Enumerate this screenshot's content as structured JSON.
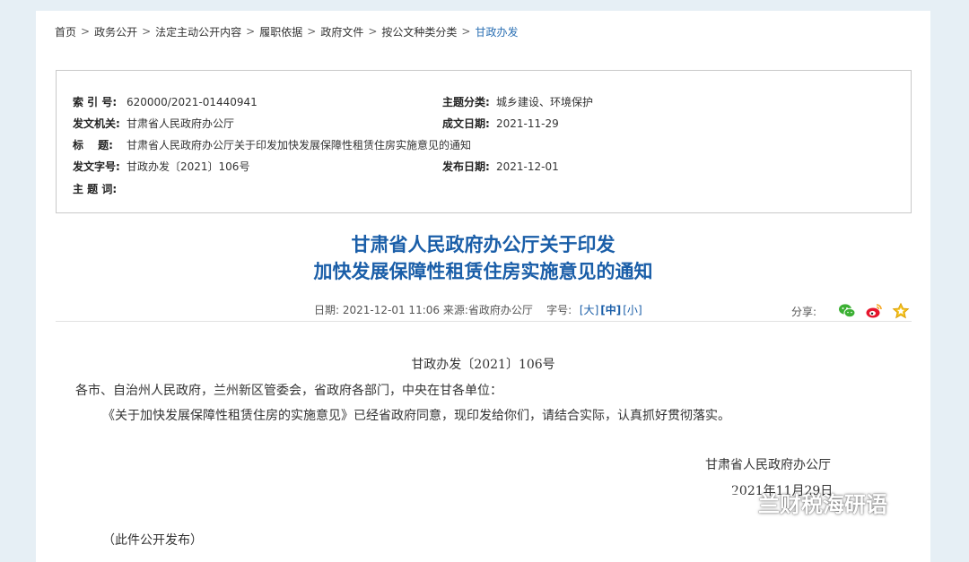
{
  "breadcrumb": {
    "items": [
      "首页",
      "政务公开",
      "法定主动公开内容",
      "履职依据",
      "政府文件",
      "按公文种类分类"
    ],
    "current": "甘政办发",
    "separator": ">"
  },
  "meta": {
    "index_label": "索 引 号:",
    "index_value": "620000/2021-01440941",
    "topic_label": "主题分类:",
    "topic_value": "城乡建设、环境保护",
    "issuer_label": "发文机关:",
    "issuer_value": "甘肃省人民政府办公厅",
    "written_label": "成文日期:",
    "written_value": "2021-11-29",
    "title_label": "标　 题:",
    "title_value": "甘肃省人民政府办公厅关于印发加快发展保障性租赁住房实施意见的通知",
    "docno_label": "发文字号:",
    "docno_value": "甘政办发〔2021〕106号",
    "publish_label": "发布日期:",
    "publish_value": "2021-12-01",
    "keywords_label": "主 题 词:",
    "keywords_value": ""
  },
  "article": {
    "title_line1": "甘肃省人民政府办公厅关于印发",
    "title_line2": "加快发展保障性租赁住房实施意见的通知",
    "date_label": "日期:",
    "date_value": "2021-12-01 11:06",
    "source_label": "来源:",
    "source_value": "省政府办公厅",
    "fontsize_label": "字号:",
    "size_large": "大",
    "size_medium": "中",
    "size_small": "小",
    "share_label": "分享:",
    "doc_number": "甘政办发〔2021〕106号",
    "recipients": "各市、自治州人民政府，兰州新区管委会，省政府各部门，中央在甘各单位：",
    "paragraph1": "《关于加快发展保障性租赁住房的实施意见》已经省政府同意，现印发给你们，请结合实际，认真抓好贯彻落实。",
    "signature": "甘肃省人民政府办公厅",
    "sign_date": "2021年11月29日",
    "public_note": "（此件公开发布）"
  },
  "watermark": {
    "text": "兰财税海研语"
  },
  "colors": {
    "accent": "#1a5ea8",
    "background": "#e6eff5"
  },
  "icons": {
    "wechat": "wechat-icon",
    "weibo": "weibo-icon",
    "favorite": "star-icon"
  }
}
